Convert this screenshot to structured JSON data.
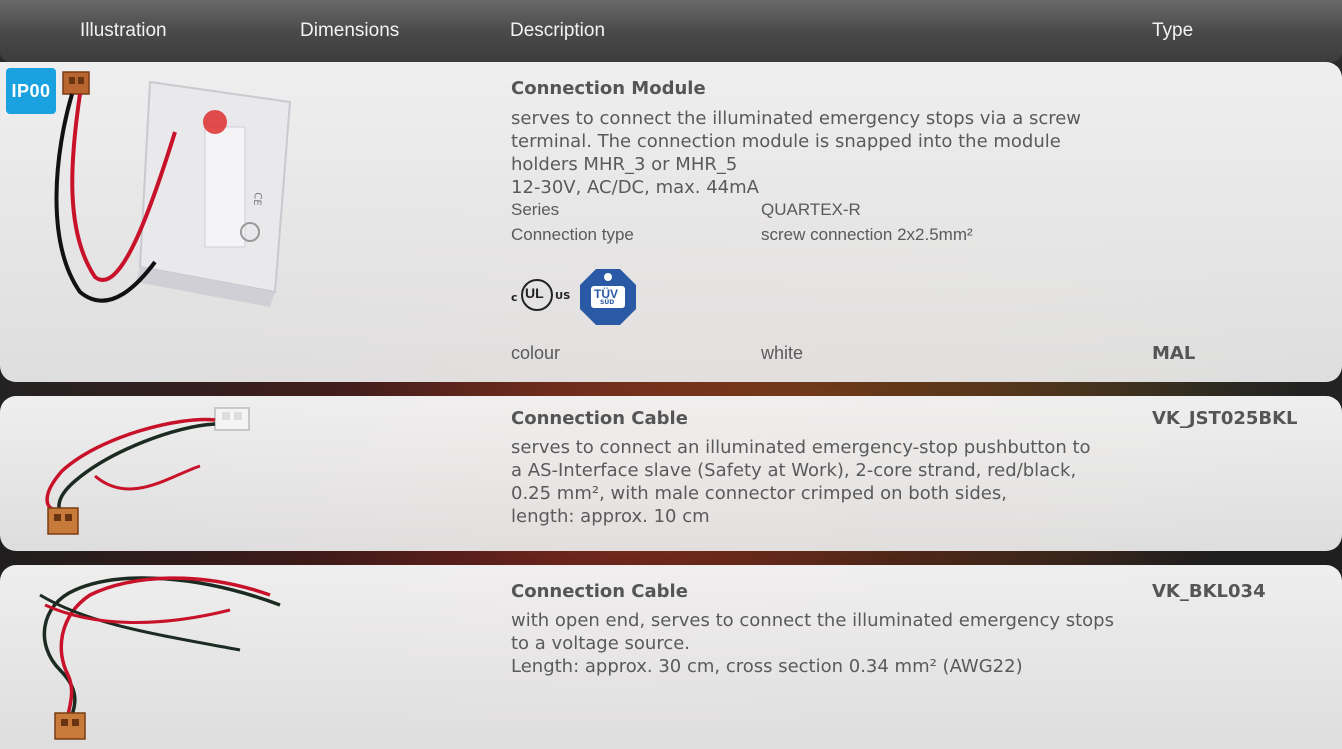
{
  "header": {
    "illustration": "Illustration",
    "dimensions": "Dimensions",
    "description": "Description",
    "type": "Type"
  },
  "badge": "IP00",
  "rows": [
    {
      "title": "Connection Module",
      "description_lines": [
        "serves to connect the illuminated emergency stops via a screw",
        "terminal. The connection module is snapped into the module",
        "holders MHR_3 or MHR_5",
        "12-30V, AC/DC, max. 44mA"
      ],
      "specs": [
        {
          "label": "Series",
          "value": "QUARTEX-R"
        },
        {
          "label": "Connection type",
          "value": "screw connection 2x2.5mm²"
        }
      ],
      "cert_ul": {
        "left": "c",
        "center": "UL",
        "right": "US"
      },
      "cert_tuv": {
        "main": "TÜV",
        "sub": "SÜD"
      },
      "colour_label": "colour",
      "colour_value": "white",
      "type": "MAL"
    },
    {
      "title": "Connection Cable",
      "description_lines": [
        "serves to connect an illuminated emergency-stop pushbutton to",
        "a AS-Interface slave (Safety at Work), 2-core strand, red/black,",
        "0.25 mm², with male connector crimped on both sides,",
        "length: approx. 10 cm"
      ],
      "type": "VK_JST025BKL"
    },
    {
      "title": "Connection Cable",
      "description_lines": [
        "with open end, serves to connect the illuminated emergency stops",
        "to a voltage source.",
        "Length: approx. 30 cm, cross section 0.34 mm² (AWG22)"
      ],
      "type": "VK_BKL034"
    }
  ],
  "colors": {
    "header_bg": "#4a4a4a",
    "row_bg": "#efefef",
    "badge_bg": "#1aa2e0",
    "tuv_blue": "#2a5aa6"
  }
}
